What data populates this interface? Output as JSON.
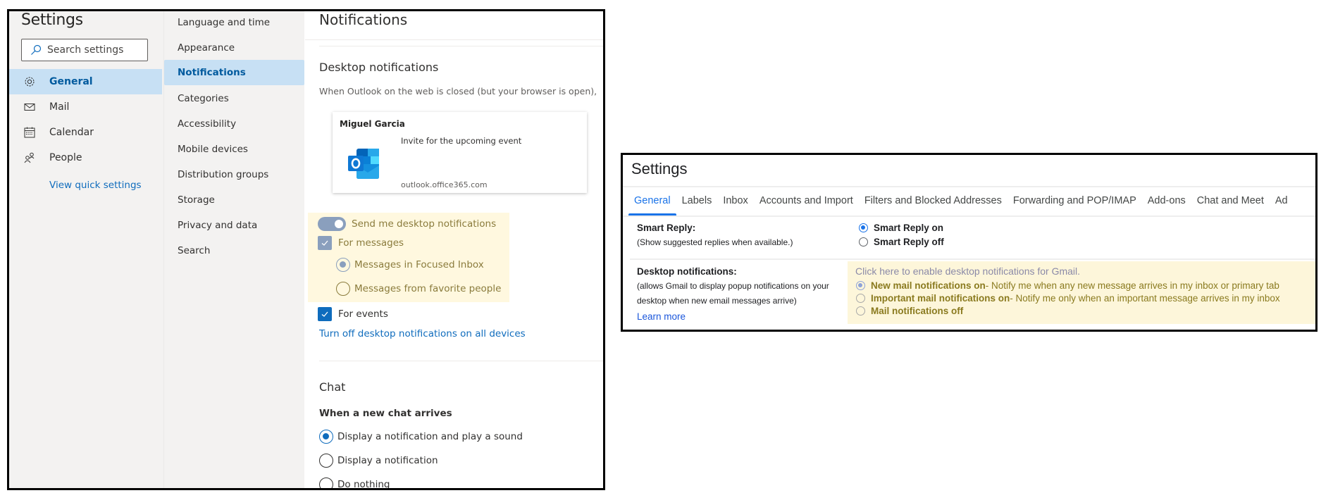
{
  "outlook": {
    "title": "Settings",
    "search_placeholder": "Search settings",
    "nav": [
      {
        "label": "General",
        "icon": "gear-icon",
        "active": true
      },
      {
        "label": "Mail",
        "icon": "mail-icon",
        "active": false
      },
      {
        "label": "Calendar",
        "icon": "calendar-icon",
        "active": false
      },
      {
        "label": "People",
        "icon": "people-icon",
        "active": false
      }
    ],
    "quick_settings_link": "View quick settings",
    "subnav": [
      {
        "label": "Language and time",
        "active": false
      },
      {
        "label": "Appearance",
        "active": false
      },
      {
        "label": "Notifications",
        "active": true
      },
      {
        "label": "Categories",
        "active": false
      },
      {
        "label": "Accessibility",
        "active": false
      },
      {
        "label": "Mobile devices",
        "active": false
      },
      {
        "label": "Distribution groups",
        "active": false
      },
      {
        "label": "Storage",
        "active": false
      },
      {
        "label": "Privacy and data",
        "active": false
      },
      {
        "label": "Search",
        "active": false
      }
    ],
    "content": {
      "heading": "Notifications",
      "desktop_section": "Desktop notifications",
      "desktop_description": "When Outlook on the web is closed (but your browser is open),",
      "preview": {
        "sender": "Miguel Garcia",
        "subject": "Invite for the upcoming event",
        "host": "outlook.office365.com",
        "icon": "outlook-logo-icon"
      },
      "toggle_label": "Send me desktop notifications",
      "toggle_on": true,
      "for_messages_label": "For messages",
      "for_messages_checked": true,
      "message_options": [
        {
          "label": "Messages in Focused Inbox",
          "selected": true
        },
        {
          "label": "Messages from favorite people",
          "selected": false
        }
      ],
      "for_events_label": "For events",
      "for_events_checked": true,
      "turn_off_link": "Turn off desktop notifications on all devices",
      "chat_section": "Chat",
      "chat_subheading": "When a new chat arrives",
      "chat_options": [
        {
          "label": "Display a notification and play a sound",
          "selected": true
        },
        {
          "label": "Display a notification",
          "selected": false
        },
        {
          "label": "Do nothing",
          "selected": false
        }
      ]
    },
    "colors": {
      "accent": "#0f6cbd",
      "highlight": "#fff8df",
      "nav_active": "#c7e0f4"
    }
  },
  "gmail": {
    "title": "Settings",
    "tabs": [
      {
        "label": "General",
        "active": true
      },
      {
        "label": "Labels",
        "active": false
      },
      {
        "label": "Inbox",
        "active": false
      },
      {
        "label": "Accounts and Import",
        "active": false
      },
      {
        "label": "Filters and Blocked Addresses",
        "active": false
      },
      {
        "label": "Forwarding and POP/IMAP",
        "active": false
      },
      {
        "label": "Add-ons",
        "active": false
      },
      {
        "label": "Chat and Meet",
        "active": false
      },
      {
        "label": "Ad",
        "active": false
      }
    ],
    "smart_reply": {
      "label": "Smart Reply:",
      "note": "(Show suggested replies when available.)",
      "options": [
        {
          "label": "Smart Reply on",
          "selected": true
        },
        {
          "label": "Smart Reply off",
          "selected": false
        }
      ]
    },
    "desktop_notifications": {
      "label": "Desktop notifications:",
      "note_line1": "(allows Gmail to display popup notifications on your",
      "note_line2": "desktop when new email messages arrive)",
      "learn_more": "Learn more",
      "enable_prompt": "Click here to enable desktop notifications for Gmail.",
      "options": [
        {
          "label": "New mail notifications on",
          "description": " - Notify me when any new message arrives in my inbox or primary tab",
          "selected": true
        },
        {
          "label": "Important mail notifications on",
          "description": " - Notify me only when an important message arrives in my inbox",
          "selected": false
        },
        {
          "label": "Mail notifications off",
          "description": "",
          "selected": false
        }
      ]
    },
    "colors": {
      "accent": "#1a73e8",
      "highlight": "#fdf6da"
    }
  }
}
